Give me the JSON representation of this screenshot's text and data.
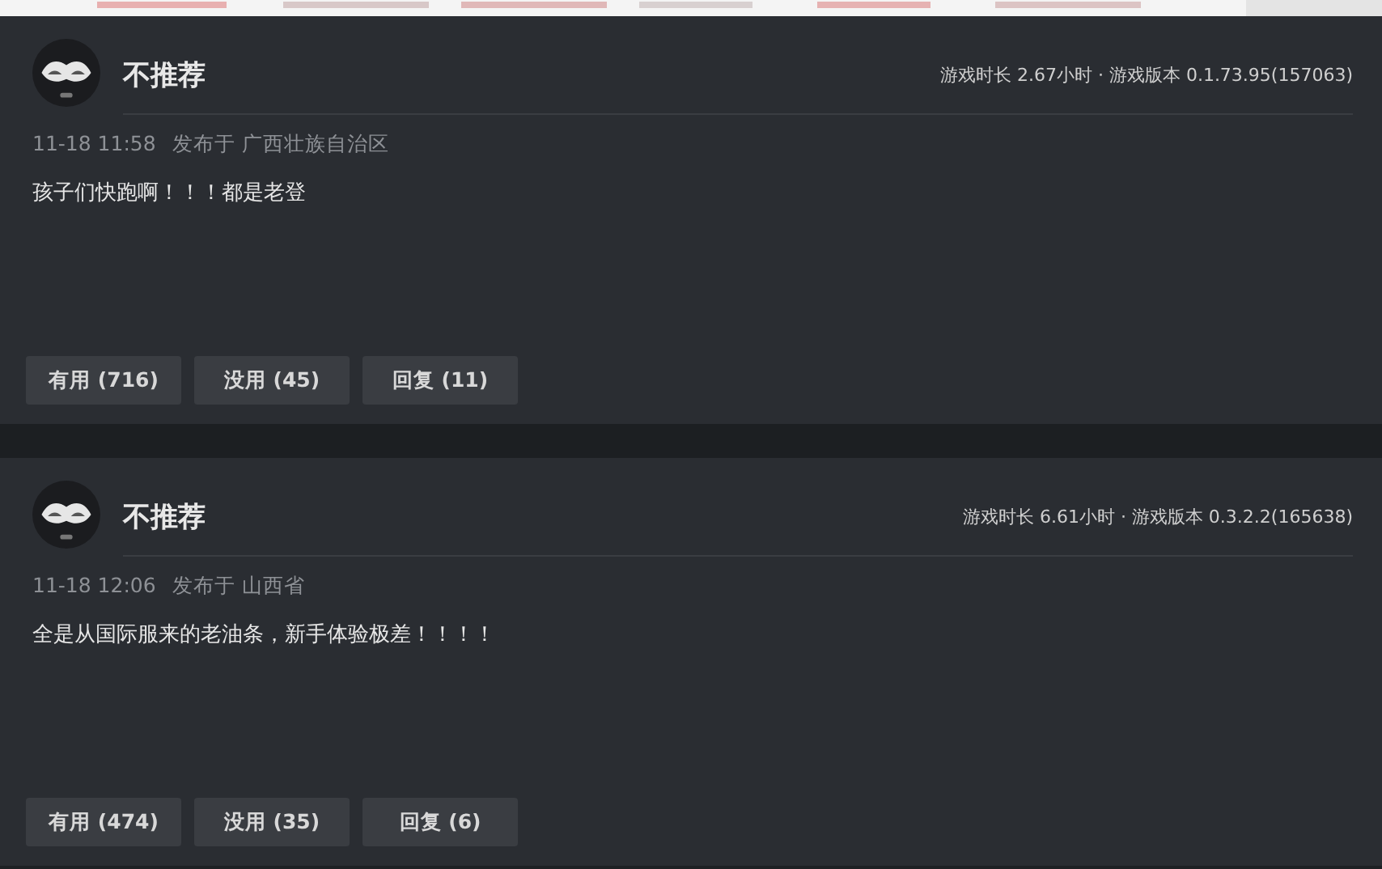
{
  "reviews": [
    {
      "verdict": "不推荐",
      "meta": "游戏时长 2.67小时 · 游戏版本 0.1.73.95(157063)",
      "time": "11-18 11:58",
      "location": "发布于 广西壮族自治区",
      "content": "孩子们快跑啊！！！都是老登",
      "buttons": [
        "有用 (716)",
        "没用 (45)",
        "回复 (11)"
      ]
    },
    {
      "verdict": "不推荐",
      "meta": "游戏时长 6.61小时 · 游戏版本 0.3.2.2(165638)",
      "time": "11-18 12:06",
      "location": "发布于 山西省",
      "content": "全是从国际服来的老油条，新手体验极差！！！！",
      "buttons": [
        "有用 (474)",
        "没用 (35)",
        "回复 (6)"
      ]
    }
  ]
}
